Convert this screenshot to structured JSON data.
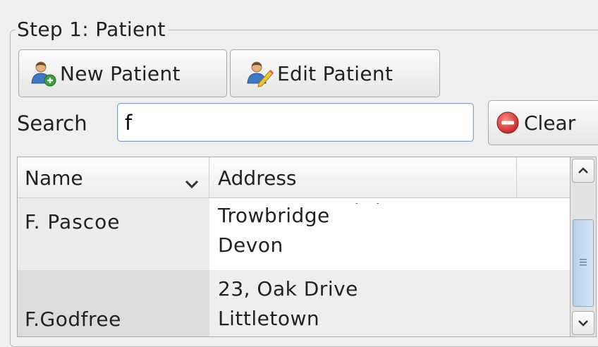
{
  "group": {
    "title": "Step 1: Patient"
  },
  "buttons": {
    "new_patient": "New Patient",
    "edit_patient": "Edit Patient",
    "clear": "Clear"
  },
  "search": {
    "label": "Search",
    "value": "f"
  },
  "table": {
    "columns": [
      "Name",
      "Address"
    ],
    "rows": [
      {
        "name": "F. Pascoe",
        "address": [
          "Trowbridge",
          "Devon"
        ]
      },
      {
        "name": "F.Godfree",
        "address": [
          "23, Oak Drive",
          "Littletown"
        ]
      }
    ]
  },
  "icons": {
    "new_patient": "user-add-icon",
    "edit_patient": "user-edit-icon",
    "clear": "remove-circle-icon",
    "sort": "chevron-down-icon"
  },
  "colors": {
    "accent": "#7fa2c8",
    "clear_red": "#d9362b"
  }
}
